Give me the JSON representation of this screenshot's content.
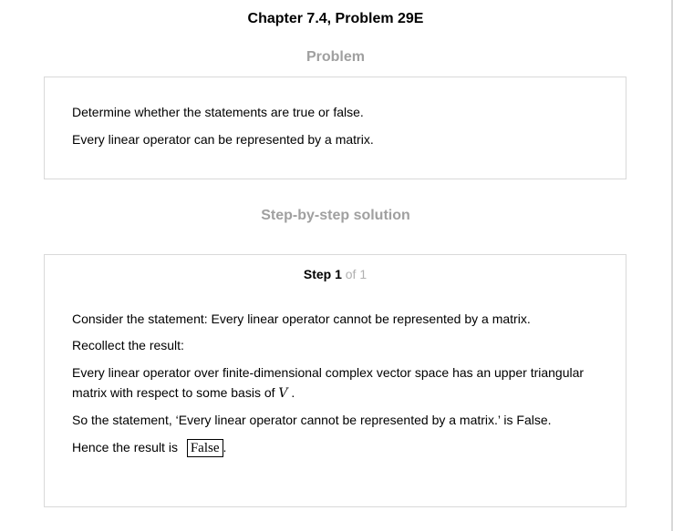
{
  "header": {
    "title": "Chapter 7.4, Problem 29E"
  },
  "problem": {
    "heading": "Problem",
    "paragraphs": [
      "Determine whether the statements are true or false.",
      "Every linear operator can be represented by a matrix."
    ]
  },
  "solution": {
    "heading": "Step-by-step solution",
    "step_label": "Step 1",
    "step_of": " of 1",
    "paragraphs": {
      "p1": "Consider the statement: Every linear operator cannot be represented by a matrix.",
      "p2": "Recollect the result:",
      "p3_text": "Every linear operator over finite-dimensional complex vector space has an upper triangular matrix with respect to some basis of ",
      "p3_var": "V",
      "p3_end": " .",
      "p4": "So the statement, ‘Every linear operator cannot be represented by a matrix.’ is False.",
      "p5_text": "Hence the result is ",
      "p5_answer": "False",
      "p5_end": "."
    }
  }
}
